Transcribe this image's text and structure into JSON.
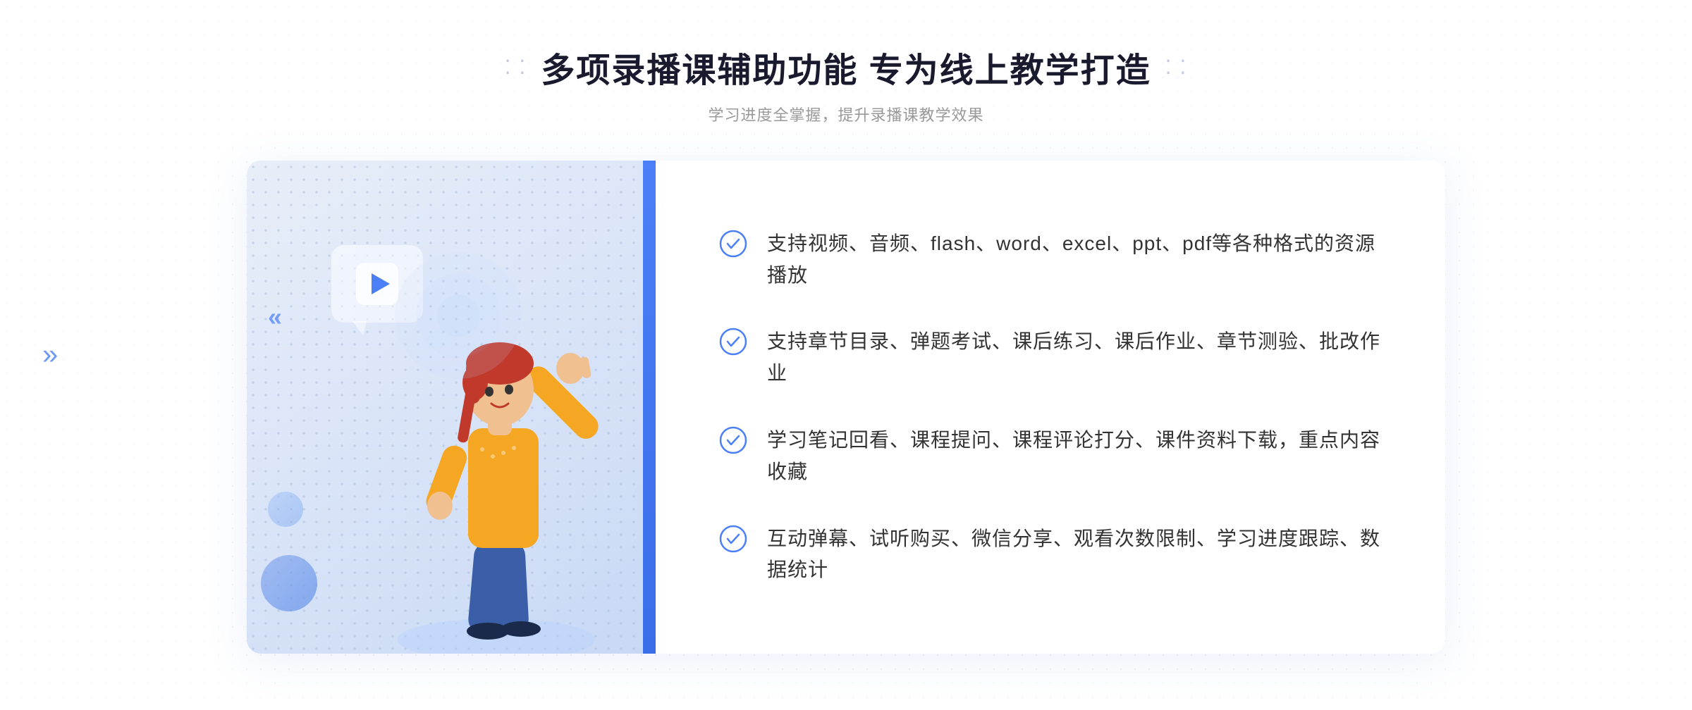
{
  "header": {
    "title": "多项录播课辅助功能 专为线上教学打造",
    "subtitle": "学习进度全掌握，提升录播课教学效果",
    "title_dots_left": "⁞ ⁞",
    "title_dots_right": "⁞ ⁞"
  },
  "features": [
    {
      "id": 1,
      "text": "支持视频、音频、flash、word、excel、ppt、pdf等各种格式的资源播放"
    },
    {
      "id": 2,
      "text": "支持章节目录、弹题考试、课后练习、课后作业、章节测验、批改作业"
    },
    {
      "id": 3,
      "text": "学习笔记回看、课程提问、课程评论打分、课件资料下载，重点内容收藏"
    },
    {
      "id": 4,
      "text": "互动弹幕、试听购买、微信分享、观看次数限制、学习进度跟踪、数据统计"
    }
  ],
  "icons": {
    "check": "check-circle-icon",
    "play": "play-icon",
    "left_arrow": "left-chevron-icon"
  },
  "colors": {
    "primary": "#4a7ff7",
    "title": "#1a1a2e",
    "text": "#333333",
    "subtitle": "#999999",
    "bg_light": "#e8eef8"
  }
}
